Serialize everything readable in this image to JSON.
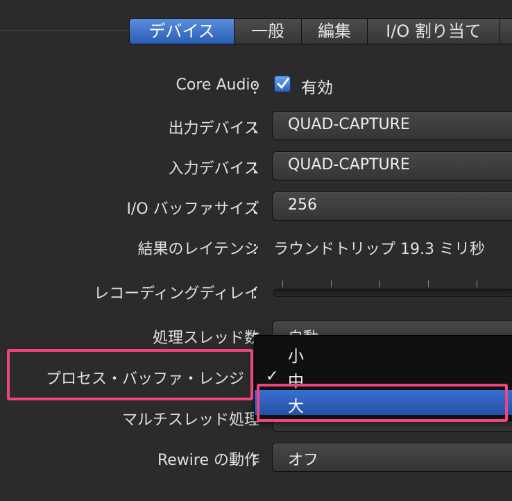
{
  "tabs": [
    "デバイス",
    "一般",
    "編集",
    "I/O 割り当て"
  ],
  "rows": {
    "core_audio": {
      "label": "Core Audio",
      "checkbox_label": "有効",
      "checked": true
    },
    "output_device": {
      "label": "出力デバイス",
      "value": "QUAD-CAPTURE"
    },
    "input_device": {
      "label": "入力デバイス",
      "value": "QUAD-CAPTURE"
    },
    "io_buffer": {
      "label": "I/O バッファサイズ",
      "value": "256"
    },
    "latency": {
      "label": "結果のレイテンシ",
      "value": "ラウンドトリップ 19.3 ミリ秒"
    },
    "recording_delay": {
      "label": "レコーディングディレイ"
    },
    "threads": {
      "label": "処理スレッド数",
      "value": "自動"
    },
    "process_buffer": {
      "label": "プロセス・バッファ・レンジ"
    },
    "multithread": {
      "label": "マルチスレッド処理"
    },
    "rewire": {
      "label": "Rewire の動作",
      "value": "オフ"
    }
  },
  "colon": "：",
  "menu": {
    "items": [
      {
        "label": "小",
        "checked": false,
        "selected": false
      },
      {
        "label": "中",
        "checked": true,
        "selected": false
      },
      {
        "label": "大",
        "checked": false,
        "selected": true
      }
    ],
    "check_glyph": "✓"
  },
  "colors": {
    "accent": "#2a5db6",
    "highlight": "#f0457c",
    "background": "#2b2b2c"
  }
}
